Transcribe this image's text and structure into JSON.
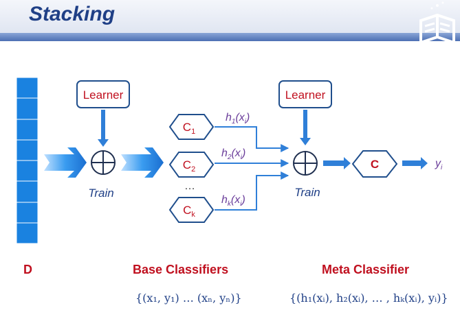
{
  "title": "Stacking",
  "diagram": {
    "learner_left": "Learner",
    "learner_right": "Learner",
    "train_left": "Train",
    "train_right": "Train",
    "base_classifiers": [
      {
        "base": "C",
        "sub": "1"
      },
      {
        "base": "C",
        "sub": "2"
      },
      {
        "base": "C",
        "sub": "k"
      }
    ],
    "ellipsis": "…",
    "outputs": [
      {
        "h": "h",
        "hsub": "1",
        "x": "x",
        "xsub": "i"
      },
      {
        "h": "h",
        "hsub": "2",
        "x": "x",
        "xsub": "i"
      },
      {
        "h": "h",
        "hsub": "k",
        "x": "x",
        "xsub": "i"
      }
    ],
    "meta_classifier": "C",
    "result": {
      "y": "y",
      "sub": "i"
    }
  },
  "bottom": {
    "d_label": "D",
    "base_label": "Base Classifiers",
    "meta_label": "Meta Classifier",
    "base_set": "{(x₁, y₁) … (xₙ, yₙ)}",
    "meta_set": "{(h₁(xᵢ), h₂(xᵢ), … , hₖ(xᵢ), yᵢ)}"
  },
  "colors": {
    "title": "#1f3f86",
    "accent_red": "#c0101f",
    "purple": "#6a3d9a",
    "box_border": "#1f4e8c",
    "arrow_blue": "#2f7fd8",
    "data_blue": "#1a82e0"
  }
}
